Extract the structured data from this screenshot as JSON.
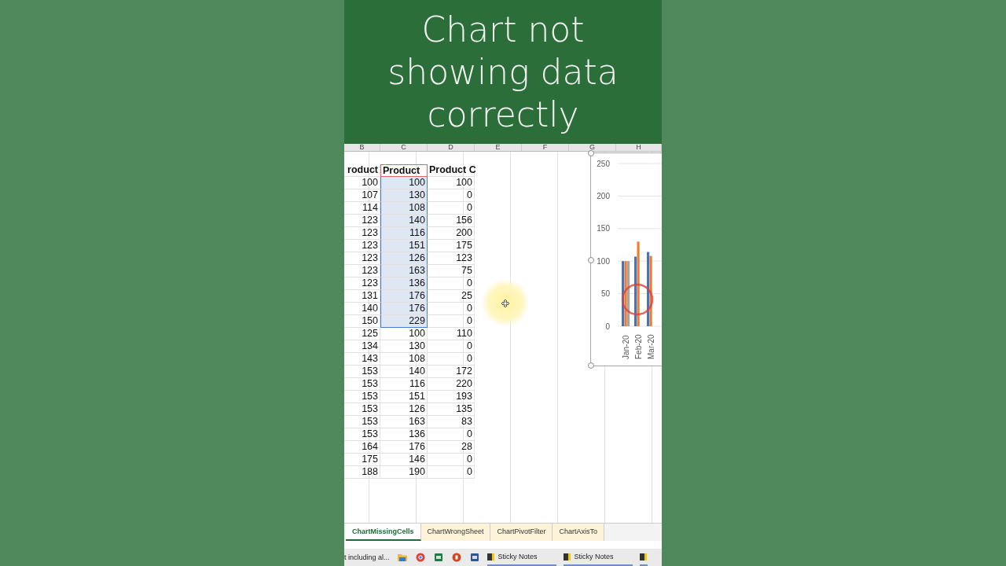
{
  "banner": {
    "title": "Chart not showing data correctly"
  },
  "columns": [
    "B",
    "C",
    "D",
    "E",
    "F",
    "G",
    "H"
  ],
  "header": {
    "cells": [
      "roduct",
      "Product",
      "Product C"
    ],
    "selected": true
  },
  "rows": [
    {
      "cells": [
        "100",
        "100",
        "100"
      ],
      "selected": true
    },
    {
      "cells": [
        "107",
        "130",
        "0"
      ],
      "selected": true
    },
    {
      "cells": [
        "114",
        "108",
        "0"
      ],
      "selected": true
    },
    {
      "cells": [
        "123",
        "140",
        "156"
      ],
      "selected": true
    },
    {
      "cells": [
        "123",
        "116",
        "200"
      ],
      "selected": true
    },
    {
      "cells": [
        "123",
        "151",
        "175"
      ],
      "selected": true
    },
    {
      "cells": [
        "123",
        "126",
        "123"
      ],
      "selected": true
    },
    {
      "cells": [
        "123",
        "163",
        "75"
      ],
      "selected": true
    },
    {
      "cells": [
        "123",
        "136",
        "0"
      ],
      "selected": true
    },
    {
      "cells": [
        "131",
        "176",
        "25"
      ],
      "selected": true
    },
    {
      "cells": [
        "140",
        "176",
        "0"
      ],
      "selected": true
    },
    {
      "cells": [
        "150",
        "229",
        "0"
      ],
      "selected": true
    },
    {
      "cells": [
        "125",
        "100",
        "110"
      ],
      "selected": false
    },
    {
      "cells": [
        "134",
        "130",
        "0"
      ],
      "selected": false
    },
    {
      "cells": [
        "143",
        "108",
        "0"
      ],
      "selected": false
    },
    {
      "cells": [
        "153",
        "140",
        "172"
      ],
      "selected": false
    },
    {
      "cells": [
        "153",
        "116",
        "220"
      ],
      "selected": false
    },
    {
      "cells": [
        "153",
        "151",
        "193"
      ],
      "selected": false
    },
    {
      "cells": [
        "153",
        "126",
        "135"
      ],
      "selected": false
    },
    {
      "cells": [
        "153",
        "163",
        "83"
      ],
      "selected": false
    },
    {
      "cells": [
        "153",
        "136",
        "0"
      ],
      "selected": false
    },
    {
      "cells": [
        "164",
        "176",
        "28"
      ],
      "selected": false
    },
    {
      "cells": [
        "175",
        "146",
        "0"
      ],
      "selected": false
    },
    {
      "cells": [
        "188",
        "190",
        "0"
      ],
      "selected": false
    }
  ],
  "chart": {
    "chart_data": {
      "type": "bar",
      "grid": true,
      "categories": [
        "Jan-20",
        "Feb-20",
        "Mar-20"
      ],
      "ylim": [
        0,
        250
      ],
      "yticks": [
        0,
        50,
        100,
        150,
        200,
        250
      ],
      "series": [
        {
          "color": "#4472c4",
          "values": [
            100,
            107,
            114
          ]
        },
        {
          "color": "#ed7d31",
          "values": [
            100,
            130,
            108
          ]
        },
        {
          "color": "#a5a5a5",
          "values": [
            100,
            0,
            0
          ]
        }
      ]
    }
  },
  "sheet_tabs": [
    {
      "label": "ChartMissingCells",
      "selected": true
    },
    {
      "label": "ChartWrongSheet",
      "selected": false
    },
    {
      "label": "ChartPivotFilter",
      "selected": false
    },
    {
      "label": "ChartAxisTo",
      "selected": false
    }
  ],
  "taskbar": [
    {
      "kind": "window",
      "label": "t including al..."
    },
    {
      "kind": "folder"
    },
    {
      "kind": "browser"
    },
    {
      "kind": "excel"
    },
    {
      "kind": "powerpoint"
    },
    {
      "kind": "word"
    },
    {
      "kind": "notes",
      "label": "Sticky Notes"
    },
    {
      "kind": "notes",
      "label": "Sticky Notes"
    },
    {
      "kind": "notes"
    }
  ]
}
